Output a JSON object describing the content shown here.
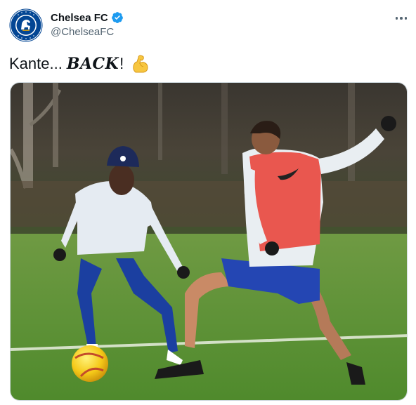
{
  "author": {
    "display_name": "Chelsea FC",
    "handle": "@ChelseaFC",
    "verified": true,
    "avatar_icon": "chelsea-crest-icon",
    "avatar_crest_text": "CHELSEA FOOTBALL CLUB"
  },
  "tweet": {
    "text_before": "Kante...",
    "text_emphasis": "BACK",
    "text_after": "!",
    "emoji": "flexed-biceps-icon"
  },
  "menu": {
    "more_icon": "more-options-icon"
  },
  "media": {
    "type": "photo",
    "description_icon": "training-photo"
  },
  "colors": {
    "verified_blue": "#1d9bf0",
    "chelsea_blue": "#034694",
    "text_primary": "#0f1419",
    "text_secondary": "#536471"
  }
}
